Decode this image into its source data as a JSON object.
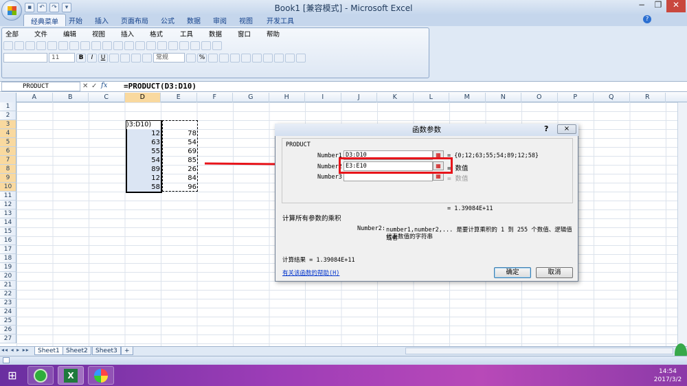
{
  "window": {
    "title": "Book1  [兼容模式] - Microsoft Excel"
  },
  "ribbon_tabs": [
    "经典菜单",
    "开始",
    "插入",
    "页面布局",
    "公式",
    "数据",
    "审阅",
    "视图",
    "开发工具"
  ],
  "classic_menu": [
    "全部",
    "文件",
    "编辑",
    "视图",
    "插入",
    "格式",
    "工具",
    "数据",
    "窗口",
    "帮助"
  ],
  "toolbar": {
    "font_size": "11",
    "style_combo": "常规",
    "bold": "B",
    "italic": "I",
    "underline": "U",
    "percent": "%"
  },
  "formula_bar": {
    "name_box": "PRODUCT",
    "fx": "fx",
    "formula": "=PRODUCT(D3:D10)"
  },
  "columns": [
    "A",
    "B",
    "C",
    "D",
    "E",
    "F",
    "G",
    "H",
    "I",
    "J",
    "K",
    "L",
    "M",
    "N",
    "O",
    "P",
    "Q",
    "R"
  ],
  "rows": [
    "1",
    "2",
    "3",
    "4",
    "5",
    "6",
    "7",
    "8",
    "9",
    "10",
    "11",
    "12",
    "13",
    "14",
    "15",
    "16",
    "17",
    "18",
    "19",
    "20",
    "21",
    "22",
    "23",
    "24",
    "25",
    "26",
    "27"
  ],
  "cells": {
    "d3_edit": ")3:D10)",
    "d_values": [
      "12",
      "63",
      "55",
      "54",
      "89",
      "12",
      "58"
    ],
    "e_values": [
      "78",
      "54",
      "69",
      "85",
      "26",
      "84",
      "96"
    ]
  },
  "dialog": {
    "title": "函数参数",
    "help_q": "?",
    "close": "×",
    "function_name": "PRODUCT",
    "args": [
      {
        "label": "Number1",
        "value": "D3:D10",
        "result": "= {0;12;63;55;54;89;12;58}"
      },
      {
        "label": "Number2",
        "value": "E3:E10",
        "result": "= 数值"
      },
      {
        "label": "Number3",
        "value": "",
        "result": "= 数值"
      }
    ],
    "total_result": "= 1.39084E+11",
    "description": "计算所有参数的乘积",
    "param_name": "Number2:",
    "param_desc_line1": "number1,number2,... 是要计算乘积的 1 到 255 个数值、逻辑值或者",
    "param_desc_line2": "代表数值的字符串",
    "calc_result": "计算结果 =  1.39084E+11",
    "help_link": "有关该函数的帮助(H)",
    "ok": "确定",
    "cancel": "取消"
  },
  "sheet_tabs": [
    "Sheet1",
    "Sheet2",
    "Sheet3"
  ],
  "taskbar": {
    "clock_time": "14:54",
    "clock_date": "2017/3/2"
  },
  "colors": {
    "highlight_red": "#e8141a",
    "selection_fill": "#dbe5f3",
    "header_selected": "#f9d99f"
  }
}
